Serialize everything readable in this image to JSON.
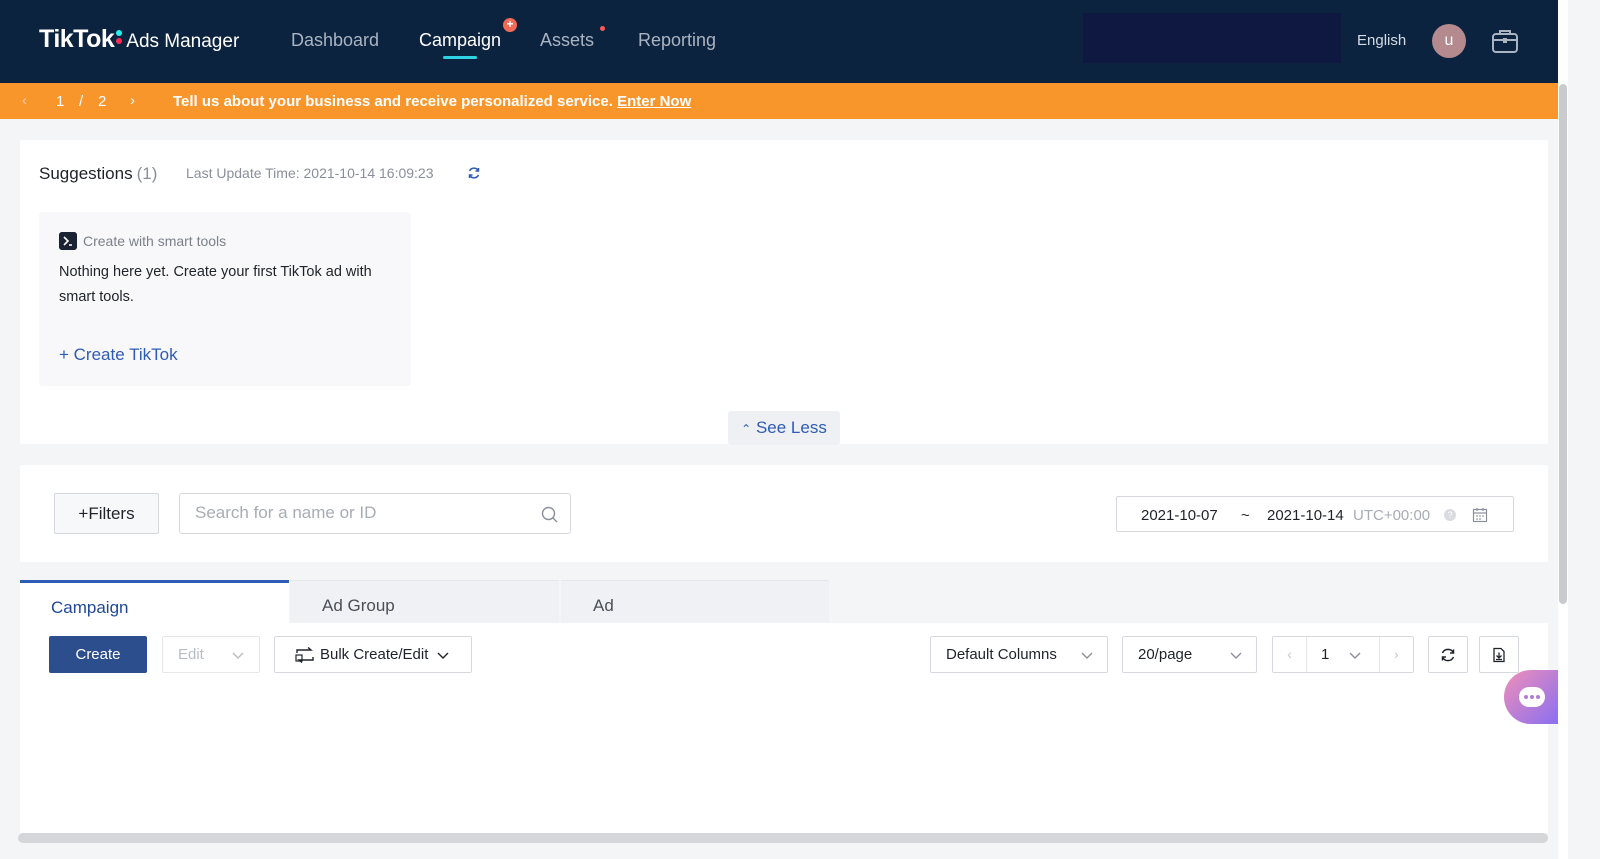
{
  "app": {
    "logo_main": "TikTok",
    "logo_sub": "Ads Manager"
  },
  "nav": {
    "items": [
      {
        "label": "Dashboard"
      },
      {
        "label": "Campaign"
      },
      {
        "label": "Assets"
      },
      {
        "label": "Reporting"
      }
    ],
    "active": "Campaign",
    "campaign_badge": "+",
    "language": "English",
    "avatar_initial": "u"
  },
  "banner": {
    "current_page": "1",
    "separator": "/",
    "total_pages": "2",
    "message": "Tell us about your business and receive personalized service.",
    "link": "Enter Now",
    "color": "#f8962c"
  },
  "suggestions": {
    "title": "Suggestions",
    "count": "(1)",
    "last_update": "Last Update Time: 2021-10-14 16:09:23",
    "card": {
      "title": "Create with smart tools",
      "description": "Nothing here yet. Create your first TikTok ad with smart tools.",
      "action": "+ Create TikTok"
    },
    "see_less": "See Less"
  },
  "filters": {
    "filters_label": "+Filters",
    "search_placeholder": "Search for a name or ID",
    "date_start": "2021-10-07",
    "date_sep": "~",
    "date_end": "2021-10-14",
    "timezone": "UTC+00:00",
    "help_glyph": "?"
  },
  "tabs": [
    {
      "label": "Campaign",
      "active": true
    },
    {
      "label": "Ad Group",
      "active": false
    },
    {
      "label": "Ad",
      "active": false
    }
  ],
  "toolbar": {
    "create": "Create",
    "edit": "Edit",
    "bulk": "Bulk Create/Edit",
    "columns": "Default Columns",
    "per_page": "20/page",
    "page": "1",
    "prev": "‹",
    "next": "›"
  },
  "colors": {
    "nav_bg": "#0c2340",
    "primary": "#2c4e8c",
    "link": "#2e5bb5",
    "accent_tab": "#2ed3e3"
  }
}
